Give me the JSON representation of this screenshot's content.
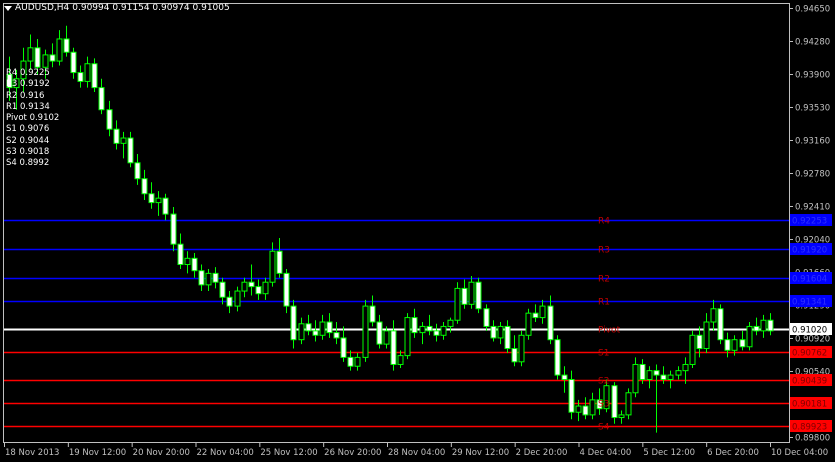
{
  "header": {
    "symbol_label": "AUDUSD,H4",
    "ohlc": "0.90994 0.91154 0.90974 0.91005"
  },
  "pivot_list": [
    "R4 0.9225",
    "R3 0.9192",
    "R2 0.916",
    "R1 0.9134",
    "Pivot 0.9102",
    "S1 0.9076",
    "S2 0.9044",
    "S3 0.9018",
    "S4 0.8992"
  ],
  "price_axis": {
    "ticks": [
      "0.94650",
      "0.94280",
      "0.93900",
      "0.93530",
      "0.93160",
      "0.92780",
      "0.92410",
      "0.92040",
      "0.91660",
      "0.91290",
      "0.90920",
      "0.90540",
      "0.90170",
      "0.89800"
    ],
    "current_price": "0.91020"
  },
  "levels": [
    {
      "name": "R4",
      "value": 0.9225,
      "tag": "0.92253",
      "color": "#0000ff",
      "tag_bg": "#0000ff"
    },
    {
      "name": "R3",
      "value": 0.9192,
      "tag": "0.91920",
      "color": "#0000ff",
      "tag_bg": "#0000ff"
    },
    {
      "name": "R2",
      "value": 0.916,
      "tag": "0.91604",
      "color": "#0000ff",
      "tag_bg": "#0000ff"
    },
    {
      "name": "R1",
      "value": 0.9134,
      "tag": "0.91341",
      "color": "#0000ff",
      "tag_bg": "#0000ff"
    },
    {
      "name": "Pivot",
      "value": 0.9102,
      "tag": "0.91020",
      "color": "#ffffff",
      "tag_bg": "#ffffff"
    },
    {
      "name": "S1",
      "value": 0.9076,
      "tag": "0.90762",
      "color": "#ff0000",
      "tag_bg": "#ff0000"
    },
    {
      "name": "S2",
      "value": 0.9044,
      "tag": "0.90439",
      "color": "#ff0000",
      "tag_bg": "#ff0000"
    },
    {
      "name": "S3",
      "value": 0.9018,
      "tag": "0.90181",
      "color": "#ff0000",
      "tag_bg": "#ff0000"
    },
    {
      "name": "S4",
      "value": 0.8992,
      "tag": "0.89923",
      "color": "#ff0000",
      "tag_bg": "#ff0000"
    }
  ],
  "time_axis": {
    "labels": [
      "18 Nov 2013",
      "19 Nov 12:00",
      "20 Nov 20:00",
      "22 Nov 04:00",
      "25 Nov 12:00",
      "26 Nov 20:00",
      "28 Nov 04:00",
      "29 Nov 12:00",
      "2 Dec 20:00",
      "4 Dec 04:00",
      "5 Dec 12:00",
      "6 Dec 20:00",
      "10 Dec 04:00"
    ]
  },
  "colors": {
    "background": "#000000",
    "candle": "#00ff00",
    "bull_body": "#000000",
    "bear_body": "#ffffff",
    "axis": "#c0c0c0",
    "resistance": "#0000ff",
    "pivot": "#ffffff",
    "support": "#ff0000",
    "level_label": "#c00000"
  },
  "chart_data": {
    "type": "candlestick",
    "symbol": "AUDUSD",
    "timeframe": "H4",
    "ylim": [
      0.898,
      0.9465
    ],
    "candles": [
      [
        0.939,
        0.941,
        0.936,
        0.9375
      ],
      [
        0.9375,
        0.9395,
        0.935,
        0.9385
      ],
      [
        0.9385,
        0.942,
        0.937,
        0.9405
      ],
      [
        0.9405,
        0.9435,
        0.9395,
        0.942
      ],
      [
        0.942,
        0.943,
        0.939,
        0.9398
      ],
      [
        0.9398,
        0.9418,
        0.9385,
        0.9412
      ],
      [
        0.9412,
        0.9425,
        0.9398,
        0.9405
      ],
      [
        0.9405,
        0.944,
        0.94,
        0.943
      ],
      [
        0.943,
        0.9445,
        0.941,
        0.9415
      ],
      [
        0.9415,
        0.942,
        0.9385,
        0.9392
      ],
      [
        0.9392,
        0.94,
        0.9375,
        0.9382
      ],
      [
        0.9382,
        0.941,
        0.9375,
        0.9402
      ],
      [
        0.9402,
        0.9408,
        0.937,
        0.9375
      ],
      [
        0.9375,
        0.9385,
        0.9345,
        0.935
      ],
      [
        0.935,
        0.936,
        0.932,
        0.9328
      ],
      [
        0.9328,
        0.9338,
        0.9305,
        0.9312
      ],
      [
        0.9312,
        0.9325,
        0.9295,
        0.9318
      ],
      [
        0.9318,
        0.9325,
        0.9285,
        0.929
      ],
      [
        0.929,
        0.93,
        0.9265,
        0.9272
      ],
      [
        0.9272,
        0.9282,
        0.9248,
        0.9255
      ],
      [
        0.9255,
        0.9268,
        0.9238,
        0.9245
      ],
      [
        0.9245,
        0.9258,
        0.923,
        0.925
      ],
      [
        0.925,
        0.9255,
        0.9225,
        0.9232
      ],
      [
        0.9232,
        0.924,
        0.919,
        0.9198
      ],
      [
        0.9198,
        0.921,
        0.917,
        0.9175
      ],
      [
        0.9175,
        0.919,
        0.9165,
        0.9182
      ],
      [
        0.9182,
        0.9188,
        0.916,
        0.9168
      ],
      [
        0.9168,
        0.9175,
        0.9145,
        0.9152
      ],
      [
        0.9152,
        0.917,
        0.9145,
        0.9165
      ],
      [
        0.9165,
        0.9172,
        0.9148,
        0.9155
      ],
      [
        0.9155,
        0.916,
        0.913,
        0.9138
      ],
      [
        0.9138,
        0.9145,
        0.912,
        0.9128
      ],
      [
        0.9128,
        0.915,
        0.9122,
        0.9145
      ],
      [
        0.9145,
        0.916,
        0.9138,
        0.9155
      ],
      [
        0.9155,
        0.9175,
        0.914,
        0.915
      ],
      [
        0.915,
        0.9158,
        0.9135,
        0.9142
      ],
      [
        0.9142,
        0.916,
        0.9135,
        0.9155
      ],
      [
        0.9155,
        0.92,
        0.915,
        0.919
      ],
      [
        0.919,
        0.9205,
        0.916,
        0.9165
      ],
      [
        0.9165,
        0.917,
        0.912,
        0.9128
      ],
      [
        0.9128,
        0.9135,
        0.908,
        0.909
      ],
      [
        0.909,
        0.9115,
        0.9085,
        0.9108
      ],
      [
        0.9108,
        0.9118,
        0.9095,
        0.91
      ],
      [
        0.91,
        0.9112,
        0.9088,
        0.9095
      ],
      [
        0.9095,
        0.9118,
        0.909,
        0.911
      ],
      [
        0.911,
        0.912,
        0.9092,
        0.9098
      ],
      [
        0.9098,
        0.911,
        0.9085,
        0.9092
      ],
      [
        0.9092,
        0.9105,
        0.9065,
        0.907
      ],
      [
        0.907,
        0.9078,
        0.9055,
        0.906
      ],
      [
        0.906,
        0.9075,
        0.9055,
        0.907
      ],
      [
        0.907,
        0.9135,
        0.9065,
        0.9128
      ],
      [
        0.9128,
        0.914,
        0.9105,
        0.911
      ],
      [
        0.911,
        0.9118,
        0.908,
        0.9085
      ],
      [
        0.9085,
        0.9105,
        0.908,
        0.91
      ],
      [
        0.91,
        0.9112,
        0.9055,
        0.9062
      ],
      [
        0.9062,
        0.9078,
        0.9058,
        0.9072
      ],
      [
        0.9072,
        0.912,
        0.9068,
        0.9115
      ],
      [
        0.9115,
        0.9125,
        0.9092,
        0.9098
      ],
      [
        0.9098,
        0.911,
        0.9085,
        0.9105
      ],
      [
        0.9105,
        0.9118,
        0.9095,
        0.91
      ],
      [
        0.91,
        0.9108,
        0.9088,
        0.9095
      ],
      [
        0.9095,
        0.911,
        0.909,
        0.9105
      ],
      [
        0.9105,
        0.9115,
        0.9098,
        0.9112
      ],
      [
        0.9112,
        0.9155,
        0.9108,
        0.9148
      ],
      [
        0.9148,
        0.9158,
        0.9125,
        0.913
      ],
      [
        0.913,
        0.9162,
        0.9125,
        0.9155
      ],
      [
        0.9155,
        0.916,
        0.912,
        0.9125
      ],
      [
        0.9125,
        0.913,
        0.91,
        0.9105
      ],
      [
        0.9105,
        0.9112,
        0.9088,
        0.9092
      ],
      [
        0.9092,
        0.911,
        0.9085,
        0.9105
      ],
      [
        0.9105,
        0.9112,
        0.9075,
        0.908
      ],
      [
        0.908,
        0.9095,
        0.906,
        0.9065
      ],
      [
        0.9065,
        0.91,
        0.906,
        0.9095
      ],
      [
        0.9095,
        0.9125,
        0.909,
        0.912
      ],
      [
        0.912,
        0.913,
        0.911,
        0.9115
      ],
      [
        0.9115,
        0.9135,
        0.9108,
        0.9128
      ],
      [
        0.9128,
        0.914,
        0.9085,
        0.909
      ],
      [
        0.909,
        0.9095,
        0.9045,
        0.905
      ],
      [
        0.905,
        0.906,
        0.903,
        0.9045
      ],
      [
        0.9045,
        0.9055,
        0.9,
        0.9008
      ],
      [
        0.9008,
        0.9022,
        0.8998,
        0.9015
      ],
      [
        0.9015,
        0.9025,
        0.9,
        0.9005
      ],
      [
        0.9005,
        0.903,
        0.9,
        0.9022
      ],
      [
        0.9022,
        0.9035,
        0.9005,
        0.9012
      ],
      [
        0.9012,
        0.9045,
        0.9008,
        0.9038
      ],
      [
        0.9038,
        0.9042,
        0.8995,
        0.9002
      ],
      [
        0.9002,
        0.901,
        0.8995,
        0.9005
      ],
      [
        0.9005,
        0.9035,
        0.9,
        0.903
      ],
      [
        0.903,
        0.907,
        0.9025,
        0.9062
      ],
      [
        0.9062,
        0.9068,
        0.904,
        0.9045
      ],
      [
        0.9045,
        0.906,
        0.9035,
        0.9055
      ],
      [
        0.9055,
        0.9062,
        0.8985,
        0.905
      ],
      [
        0.905,
        0.906,
        0.904,
        0.9045
      ],
      [
        0.9045,
        0.9055,
        0.9035,
        0.905
      ],
      [
        0.905,
        0.906,
        0.9045,
        0.9055
      ],
      [
        0.9055,
        0.907,
        0.904,
        0.9062
      ],
      [
        0.9062,
        0.91,
        0.9058,
        0.9095
      ],
      [
        0.9095,
        0.9105,
        0.907,
        0.908
      ],
      [
        0.908,
        0.912,
        0.9075,
        0.911
      ],
      [
        0.911,
        0.9135,
        0.91,
        0.9125
      ],
      [
        0.9125,
        0.913,
        0.9085,
        0.909
      ],
      [
        0.909,
        0.9098,
        0.907,
        0.9078
      ],
      [
        0.9078,
        0.9095,
        0.9072,
        0.909
      ],
      [
        0.909,
        0.91,
        0.9078,
        0.9082
      ],
      [
        0.9082,
        0.911,
        0.9078,
        0.9105
      ],
      [
        0.9105,
        0.9115,
        0.9095,
        0.91
      ],
      [
        0.91,
        0.9118,
        0.9092,
        0.9112
      ],
      [
        0.9112,
        0.912,
        0.9095,
        0.91
      ]
    ]
  }
}
